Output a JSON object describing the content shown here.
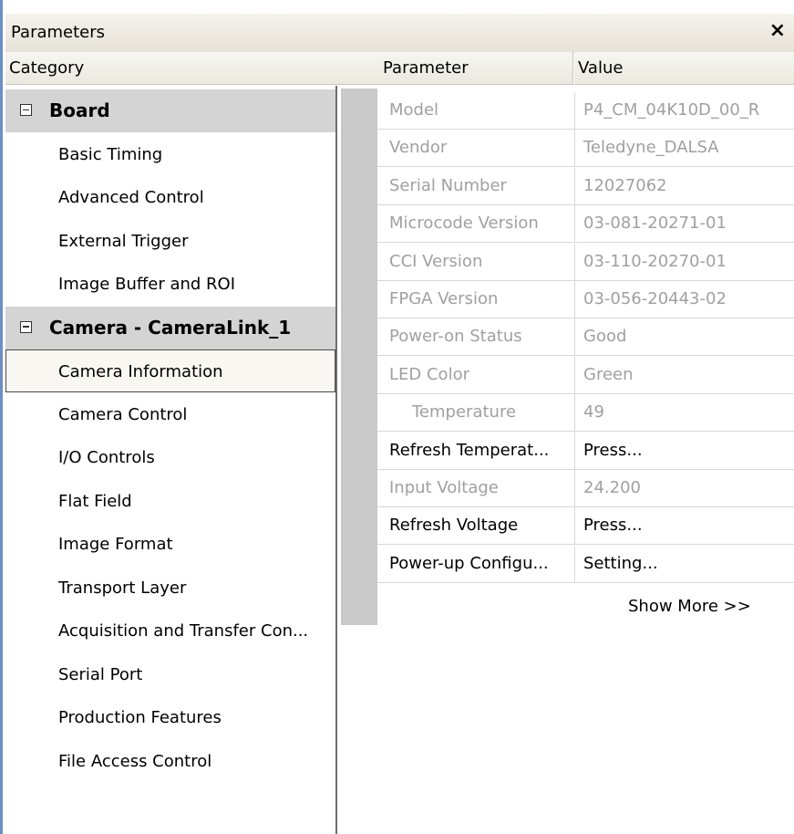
{
  "window": {
    "title": "Parameters",
    "close_glyph": "×"
  },
  "columns": {
    "category": "Category",
    "parameter": "Parameter",
    "value": "Value"
  },
  "categories": [
    {
      "label": "Board",
      "group": true
    },
    {
      "label": "Basic Timing"
    },
    {
      "label": "Advanced Control"
    },
    {
      "label": "External Trigger"
    },
    {
      "label": "Image Buffer and ROI"
    },
    {
      "label": "Camera - CameraLink_1",
      "group": true
    },
    {
      "label": "Camera Information",
      "selected": true
    },
    {
      "label": "Camera Control"
    },
    {
      "label": "I/O Controls"
    },
    {
      "label": "Flat Field"
    },
    {
      "label": "Image Format"
    },
    {
      "label": "Transport Layer"
    },
    {
      "label": "Acquisition and Transfer Con..."
    },
    {
      "label": "Serial Port"
    },
    {
      "label": "Production Features"
    },
    {
      "label": "File Access Control"
    }
  ],
  "parameters": [
    {
      "name": "Model",
      "value": "P4_CM_04K10D_00_R",
      "readonly": true
    },
    {
      "name": "Vendor",
      "value": "Teledyne_DALSA",
      "readonly": true
    },
    {
      "name": "Serial Number",
      "value": "12027062",
      "readonly": true
    },
    {
      "name": "Microcode Version",
      "value": "03-081-20271-01",
      "readonly": true
    },
    {
      "name": "CCI Version",
      "value": "03-110-20270-01",
      "readonly": true
    },
    {
      "name": "FPGA Version",
      "value": "03-056-20443-02",
      "readonly": true
    },
    {
      "name": "Power-on Status",
      "value": "Good",
      "readonly": true
    },
    {
      "name": "LED Color",
      "value": "Green",
      "readonly": true
    },
    {
      "name": "Temperature",
      "value": "49",
      "readonly": true,
      "indent": true
    },
    {
      "name": "Refresh Temperat...",
      "value": "Press...",
      "readonly": false
    },
    {
      "name": "Input Voltage",
      "value": "24.200",
      "readonly": true
    },
    {
      "name": "Refresh Voltage",
      "value": "Press...",
      "readonly": false
    },
    {
      "name": "Power-up Configu...",
      "value": "Setting...",
      "readonly": false
    }
  ],
  "show_more": "Show More >>",
  "icons": {
    "group_toggle": "collapse-box-icon",
    "close": "close-icon"
  }
}
